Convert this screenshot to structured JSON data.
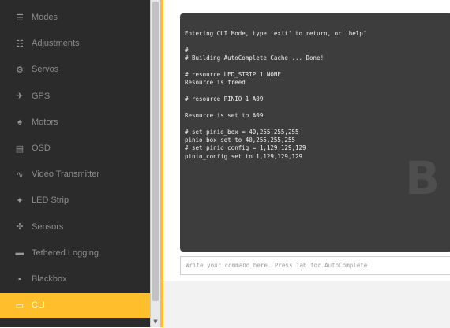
{
  "sidebar": {
    "items": [
      {
        "label": "Modes",
        "icon": "modes-icon"
      },
      {
        "label": "Adjustments",
        "icon": "adjustments-icon"
      },
      {
        "label": "Servos",
        "icon": "servos-icon"
      },
      {
        "label": "GPS",
        "icon": "gps-icon"
      },
      {
        "label": "Motors",
        "icon": "motors-icon"
      },
      {
        "label": "OSD",
        "icon": "osd-icon"
      },
      {
        "label": "Video Transmitter",
        "icon": "video-transmitter-icon"
      },
      {
        "label": "LED Strip",
        "icon": "led-strip-icon"
      },
      {
        "label": "Sensors",
        "icon": "sensors-icon"
      },
      {
        "label": "Tethered Logging",
        "icon": "tethered-logging-icon"
      },
      {
        "label": "Blackbox",
        "icon": "blackbox-icon"
      },
      {
        "label": "CLI",
        "icon": "cli-icon",
        "active": true
      }
    ]
  },
  "terminal": {
    "lines": [
      "Entering CLI Mode, type 'exit' to return, or 'help'",
      "",
      "#",
      "# Building AutoComplete Cache ... Done!",
      "",
      "# resource LED_STRIP 1 NONE",
      "Resource is freed",
      "",
      "# resource PINIO 1 A09",
      "",
      "Resource is set to A09",
      "",
      "# set pinio_box = 40,255,255,255",
      "pinio_box set to 40,255,255,255",
      "# set pinio_config = 1,129,129,129",
      "pinio_config set to 1,129,129,129"
    ],
    "watermark": "B"
  },
  "cli_input": {
    "placeholder": "Write your command here. Press Tab for AutoComplete"
  },
  "colors": {
    "accent": "#ffbe2b",
    "sidebar_bg": "#2b2b2b",
    "terminal_bg": "#3d3d3d"
  }
}
